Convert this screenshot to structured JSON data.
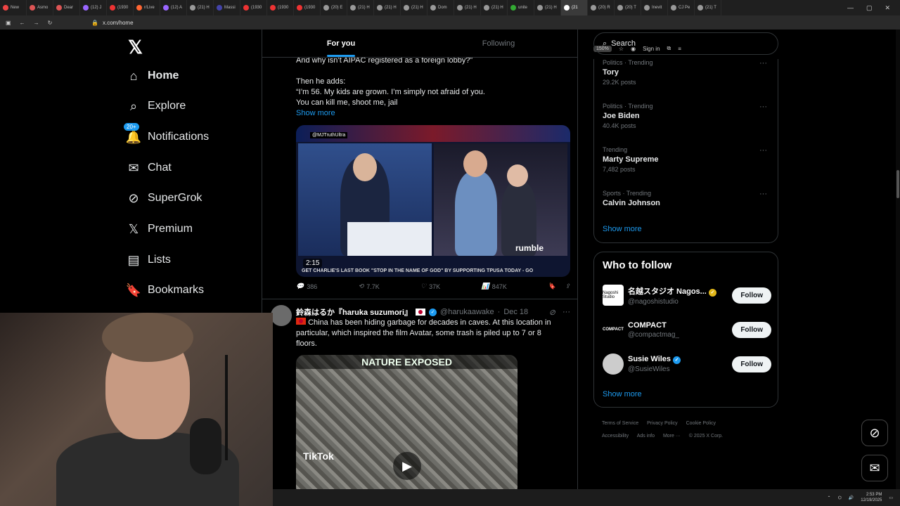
{
  "browser": {
    "tabs": [
      "New",
      "Asmo",
      "Dear",
      "(12) J",
      "(1930",
      "r/Live",
      "(12) A",
      "(21) H",
      "Massi",
      "(1930",
      "(1930",
      "(1930",
      "(20) E",
      "(21) H",
      "(21) H",
      "(21) H",
      "Dom",
      "(21) H",
      "(21) H",
      "unite",
      "(21) H",
      "(21",
      "(20) R",
      "(20) T",
      "Inevit",
      "CJ Pe",
      "(21) T"
    ],
    "url": "x.com/home",
    "zoom": "150%",
    "sign_in": "Sign in"
  },
  "nav": {
    "home": "Home",
    "explore": "Explore",
    "notifications": "Notifications",
    "notifications_badge": "20+",
    "chat": "Chat",
    "supergrok": "SuperGrok",
    "premium": "Premium",
    "lists": "Lists",
    "bookmarks": "Bookmarks"
  },
  "feed": {
    "tab_foryou": "For you",
    "tab_following": "Following",
    "post1": {
      "line1": "And why isn’t AIPAC registered as a foreign lobby?”",
      "line2": "Then he adds:",
      "line3": "“I’m 56. My kids are grown. I’m simply not afraid of you.",
      "line4": "You can kill me, shoot me, jail",
      "show_more": "Show more",
      "media_watermark": "@MJTruthUltra",
      "duration": "2:15",
      "rumble": "rumble",
      "caption": "GET CHARLIE'S LAST BOOK \"STOP IN THE NAME OF GOD\" BY SUPPORTING TPUSA TODAY - GO",
      "replies": "386",
      "reposts": "7.7K",
      "likes": "37K",
      "views": "847K"
    },
    "post2": {
      "name": "鈴森はるか『haruka suzumori』",
      "handle": "@harukaawake",
      "date": "Dec 18",
      "text_line1": "China has been hiding garbage for decades in caves. At this location in",
      "text_line2": "particular, which inspired the film Avatar, some trash is piled up to 7 or 8",
      "text_line3": "floors.",
      "media_title": "NATURE EXPOSED",
      "tiktok": "TikTok"
    }
  },
  "sidebar": {
    "search_placeholder": "Search",
    "trends": [
      {
        "cat": "Politics · Trending",
        "name": "Tory",
        "count": "29.2K posts"
      },
      {
        "cat": "Politics · Trending",
        "name": "Joe Biden",
        "count": "40.4K posts"
      },
      {
        "cat": "Trending",
        "name": "Marty Supreme",
        "count": "7,482 posts"
      },
      {
        "cat": "Sports · Trending",
        "name": "Calvin Johnson",
        "count": ""
      }
    ],
    "show_more": "Show more",
    "who_to_follow": "Who to follow",
    "follows": [
      {
        "name": "名越スタジオ Nagos...",
        "handle": "@nagoshistudio",
        "avatar": "Nagoshi Studio"
      },
      {
        "name": "COMPACT",
        "handle": "@compactmag_",
        "avatar": "COMPACT"
      },
      {
        "name": "Susie Wiles",
        "handle": "@SusieWiles",
        "avatar": ""
      }
    ],
    "follow_label": "Follow",
    "footer": [
      "Terms of Service",
      "Privacy Policy",
      "Cookie Policy",
      "Accessibility",
      "Ads info",
      "More ···",
      "© 2025 X Corp."
    ]
  },
  "taskbar": {
    "time": "2:53 PM",
    "date": "12/19/2025"
  },
  "colors": {
    "accent": "#1d9bf0",
    "background": "#000000",
    "border": "#2f3336"
  }
}
